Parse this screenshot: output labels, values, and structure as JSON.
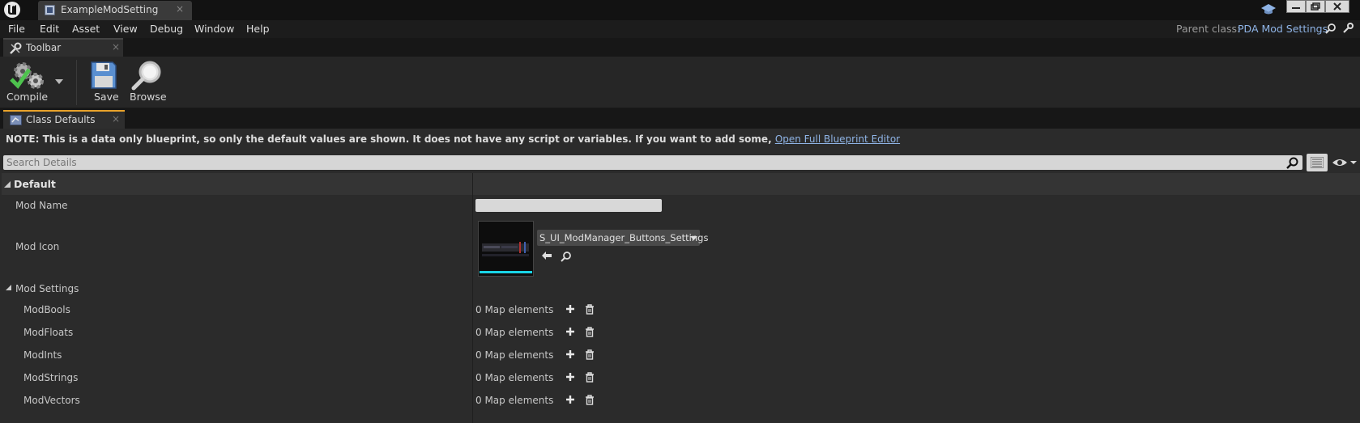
{
  "window": {
    "tab_title": "ExampleModSetting",
    "tab_close": "×"
  },
  "menu": [
    "File",
    "Edit",
    "Asset",
    "View",
    "Debug",
    "Window",
    "Help"
  ],
  "parent_class": {
    "label": "Parent class:",
    "value": "PDA Mod Settings"
  },
  "toolbar": {
    "tab_label": "Toolbar",
    "compile_label": "Compile",
    "save_label": "Save",
    "browse_label": "Browse"
  },
  "class_defaults": {
    "tab_label": "Class Defaults",
    "note": "NOTE: This is a data only blueprint, so only the default values are shown.  It does not have any script or variables.  If you want to add some, ",
    "note_link": "Open Full Blueprint Editor",
    "search_placeholder": "Search Details"
  },
  "properties": {
    "category_default": "Default",
    "mod_name_label": "Mod Name",
    "mod_name_value": "",
    "mod_icon_label": "Mod Icon",
    "mod_icon_asset": "S_UI_ModManager_Buttons_Settings",
    "mod_settings_label": "Mod Settings",
    "maps": [
      {
        "label": "ModBools",
        "value": "0 Map elements"
      },
      {
        "label": "ModFloats",
        "value": "0 Map elements"
      },
      {
        "label": "ModInts",
        "value": "0 Map elements"
      },
      {
        "label": "ModStrings",
        "value": "0 Map elements"
      },
      {
        "label": "ModVectors",
        "value": "0 Map elements"
      }
    ]
  },
  "colors": {
    "link": "#8fb4e6",
    "active_tab_accent": "#e8a22a",
    "thumbnail_accent": "#19d4e6"
  },
  "icons": [
    "unreal-logo-icon",
    "blueprint-icon",
    "graduation-cap-icon",
    "minimize-icon",
    "restore-icon",
    "close-icon",
    "search-icon",
    "wrench-icon",
    "compile-gear-icon",
    "save-disk-icon",
    "browse-magnifier-icon",
    "class-defaults-icon",
    "list-view-icon",
    "eye-icon",
    "collapse-arrow-icon",
    "use-selected-arrow-icon",
    "add-plus-icon",
    "trash-icon"
  ]
}
